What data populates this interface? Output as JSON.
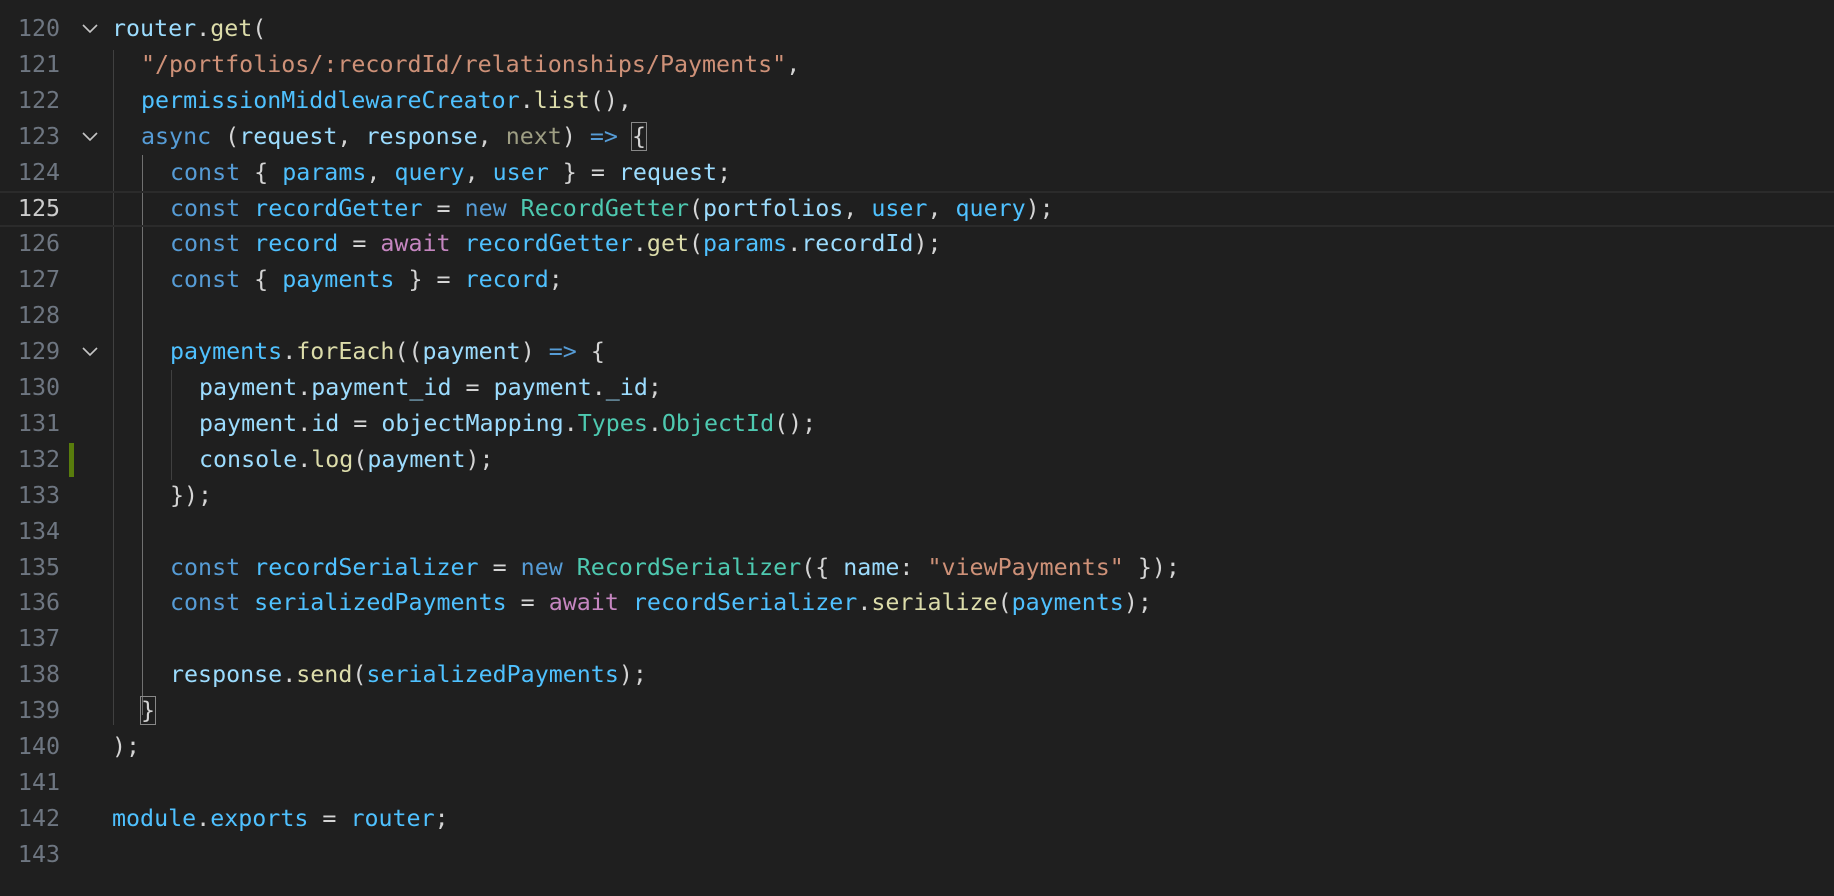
{
  "editor": {
    "accent": "#587c0c",
    "current_line": "125",
    "lines": [
      {
        "num": "120",
        "tokens": [
          [
            "v",
            "router"
          ],
          [
            "p",
            "."
          ],
          [
            "f",
            "get"
          ],
          [
            "p",
            "("
          ]
        ]
      },
      {
        "num": "121",
        "tokens": [
          [
            "s",
            "\"/portfolios/:recordId/relationships/Payments\""
          ],
          [
            "p",
            ","
          ]
        ]
      },
      {
        "num": "122",
        "tokens": [
          [
            "c",
            "permissionMiddlewareCreator"
          ],
          [
            "p",
            "."
          ],
          [
            "f",
            "list"
          ],
          [
            "p",
            "(),"
          ]
        ]
      },
      {
        "num": "123",
        "tokens": [
          [
            "k",
            "async"
          ],
          [
            "p",
            " ("
          ],
          [
            "v",
            "request"
          ],
          [
            "p",
            ", "
          ],
          [
            "v",
            "response"
          ],
          [
            "p",
            ", "
          ],
          [
            "u",
            "next"
          ],
          [
            "p",
            ") "
          ],
          [
            "k",
            "=>"
          ],
          [
            "p",
            " "
          ],
          [
            "p",
            "{"
          ]
        ]
      },
      {
        "num": "124",
        "tokens": [
          [
            "k",
            "const"
          ],
          [
            "p",
            " { "
          ],
          [
            "c",
            "params"
          ],
          [
            "p",
            ", "
          ],
          [
            "c",
            "query"
          ],
          [
            "p",
            ", "
          ],
          [
            "c",
            "user"
          ],
          [
            "p",
            " } = "
          ],
          [
            "v",
            "request"
          ],
          [
            "p",
            ";"
          ]
        ]
      },
      {
        "num": "125",
        "tokens": [
          [
            "k",
            "const"
          ],
          [
            "p",
            " "
          ],
          [
            "c",
            "recordGetter"
          ],
          [
            "p",
            " = "
          ],
          [
            "k",
            "new"
          ],
          [
            "p",
            " "
          ],
          [
            "t",
            "RecordGetter"
          ],
          [
            "p",
            "("
          ],
          [
            "v",
            "portfolios"
          ],
          [
            "p",
            ", "
          ],
          [
            "c",
            "user"
          ],
          [
            "p",
            ", "
          ],
          [
            "c",
            "query"
          ],
          [
            "p",
            ");"
          ]
        ]
      },
      {
        "num": "126",
        "tokens": [
          [
            "k",
            "const"
          ],
          [
            "p",
            " "
          ],
          [
            "c",
            "record"
          ],
          [
            "p",
            " = "
          ],
          [
            "kc",
            "await"
          ],
          [
            "p",
            " "
          ],
          [
            "c",
            "recordGetter"
          ],
          [
            "p",
            "."
          ],
          [
            "f",
            "get"
          ],
          [
            "p",
            "("
          ],
          [
            "c",
            "params"
          ],
          [
            "p",
            "."
          ],
          [
            "v",
            "recordId"
          ],
          [
            "p",
            ");"
          ]
        ]
      },
      {
        "num": "127",
        "tokens": [
          [
            "k",
            "const"
          ],
          [
            "p",
            " { "
          ],
          [
            "c",
            "payments"
          ],
          [
            "p",
            " } = "
          ],
          [
            "c",
            "record"
          ],
          [
            "p",
            ";"
          ]
        ]
      },
      {
        "num": "128",
        "tokens": []
      },
      {
        "num": "129",
        "tokens": [
          [
            "c",
            "payments"
          ],
          [
            "p",
            "."
          ],
          [
            "f",
            "forEach"
          ],
          [
            "p",
            "(("
          ],
          [
            "v",
            "payment"
          ],
          [
            "p",
            ") "
          ],
          [
            "k",
            "=>"
          ],
          [
            "p",
            " {"
          ]
        ]
      },
      {
        "num": "130",
        "tokens": [
          [
            "v",
            "payment"
          ],
          [
            "p",
            "."
          ],
          [
            "v",
            "payment_id"
          ],
          [
            "p",
            " = "
          ],
          [
            "v",
            "payment"
          ],
          [
            "p",
            "."
          ],
          [
            "v",
            "_id"
          ],
          [
            "p",
            ";"
          ]
        ]
      },
      {
        "num": "131",
        "tokens": [
          [
            "v",
            "payment"
          ],
          [
            "p",
            "."
          ],
          [
            "v",
            "id"
          ],
          [
            "p",
            " = "
          ],
          [
            "v",
            "objectMapping"
          ],
          [
            "p",
            "."
          ],
          [
            "t",
            "Types"
          ],
          [
            "p",
            "."
          ],
          [
            "t",
            "ObjectId"
          ],
          [
            "p",
            "();"
          ]
        ]
      },
      {
        "num": "132",
        "tokens": [
          [
            "v",
            "console"
          ],
          [
            "p",
            "."
          ],
          [
            "f",
            "log"
          ],
          [
            "p",
            "("
          ],
          [
            "v",
            "payment"
          ],
          [
            "p",
            ");"
          ]
        ]
      },
      {
        "num": "133",
        "tokens": [
          [
            "p",
            "});"
          ]
        ]
      },
      {
        "num": "134",
        "tokens": []
      },
      {
        "num": "135",
        "tokens": [
          [
            "k",
            "const"
          ],
          [
            "p",
            " "
          ],
          [
            "c",
            "recordSerializer"
          ],
          [
            "p",
            " = "
          ],
          [
            "k",
            "new"
          ],
          [
            "p",
            " "
          ],
          [
            "t",
            "RecordSerializer"
          ],
          [
            "p",
            "({ "
          ],
          [
            "v",
            "name"
          ],
          [
            "p",
            ": "
          ],
          [
            "s",
            "\"viewPayments\""
          ],
          [
            "p",
            " });"
          ]
        ]
      },
      {
        "num": "136",
        "tokens": [
          [
            "k",
            "const"
          ],
          [
            "p",
            " "
          ],
          [
            "c",
            "serializedPayments"
          ],
          [
            "p",
            " = "
          ],
          [
            "kc",
            "await"
          ],
          [
            "p",
            " "
          ],
          [
            "c",
            "recordSerializer"
          ],
          [
            "p",
            "."
          ],
          [
            "f",
            "serialize"
          ],
          [
            "p",
            "("
          ],
          [
            "c",
            "payments"
          ],
          [
            "p",
            ");"
          ]
        ]
      },
      {
        "num": "137",
        "tokens": []
      },
      {
        "num": "138",
        "tokens": [
          [
            "v",
            "response"
          ],
          [
            "p",
            "."
          ],
          [
            "f",
            "send"
          ],
          [
            "p",
            "("
          ],
          [
            "c",
            "serializedPayments"
          ],
          [
            "p",
            ");"
          ]
        ]
      },
      {
        "num": "139",
        "tokens": [
          [
            "p",
            "}"
          ]
        ]
      },
      {
        "num": "140",
        "tokens": [
          [
            "p",
            ");"
          ]
        ]
      },
      {
        "num": "141",
        "tokens": []
      },
      {
        "num": "142",
        "tokens": [
          [
            "c",
            "module"
          ],
          [
            "p",
            "."
          ],
          [
            "c",
            "exports"
          ],
          [
            "p",
            " = "
          ],
          [
            "c",
            "router"
          ],
          [
            "p",
            ";"
          ]
        ]
      },
      {
        "num": "143",
        "tokens": []
      }
    ]
  }
}
